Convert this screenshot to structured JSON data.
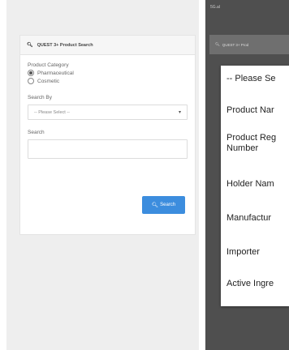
{
  "left": {
    "header": {
      "title": "QUEST 3+ Product Search",
      "icon": "search-icon"
    },
    "product_category": {
      "label": "Product Category",
      "options": [
        "Pharmaceutical",
        "Cosmetic"
      ],
      "selected": "Pharmaceutical"
    },
    "search_by": {
      "label": "Search By",
      "value": "-- Please Select --"
    },
    "search": {
      "label": "Search",
      "value": ""
    },
    "search_button": "Search",
    "accent_color": "#3c8dde"
  },
  "right": {
    "status_bar": "5G.al",
    "header_title": "QUEST 3+ Prod",
    "dropdown_options": [
      "-- Please Se",
      "Product Nar",
      "Product Reg",
      "Number",
      "Holder Nam",
      "Manufactur",
      "Importer",
      "Active Ingre"
    ]
  }
}
